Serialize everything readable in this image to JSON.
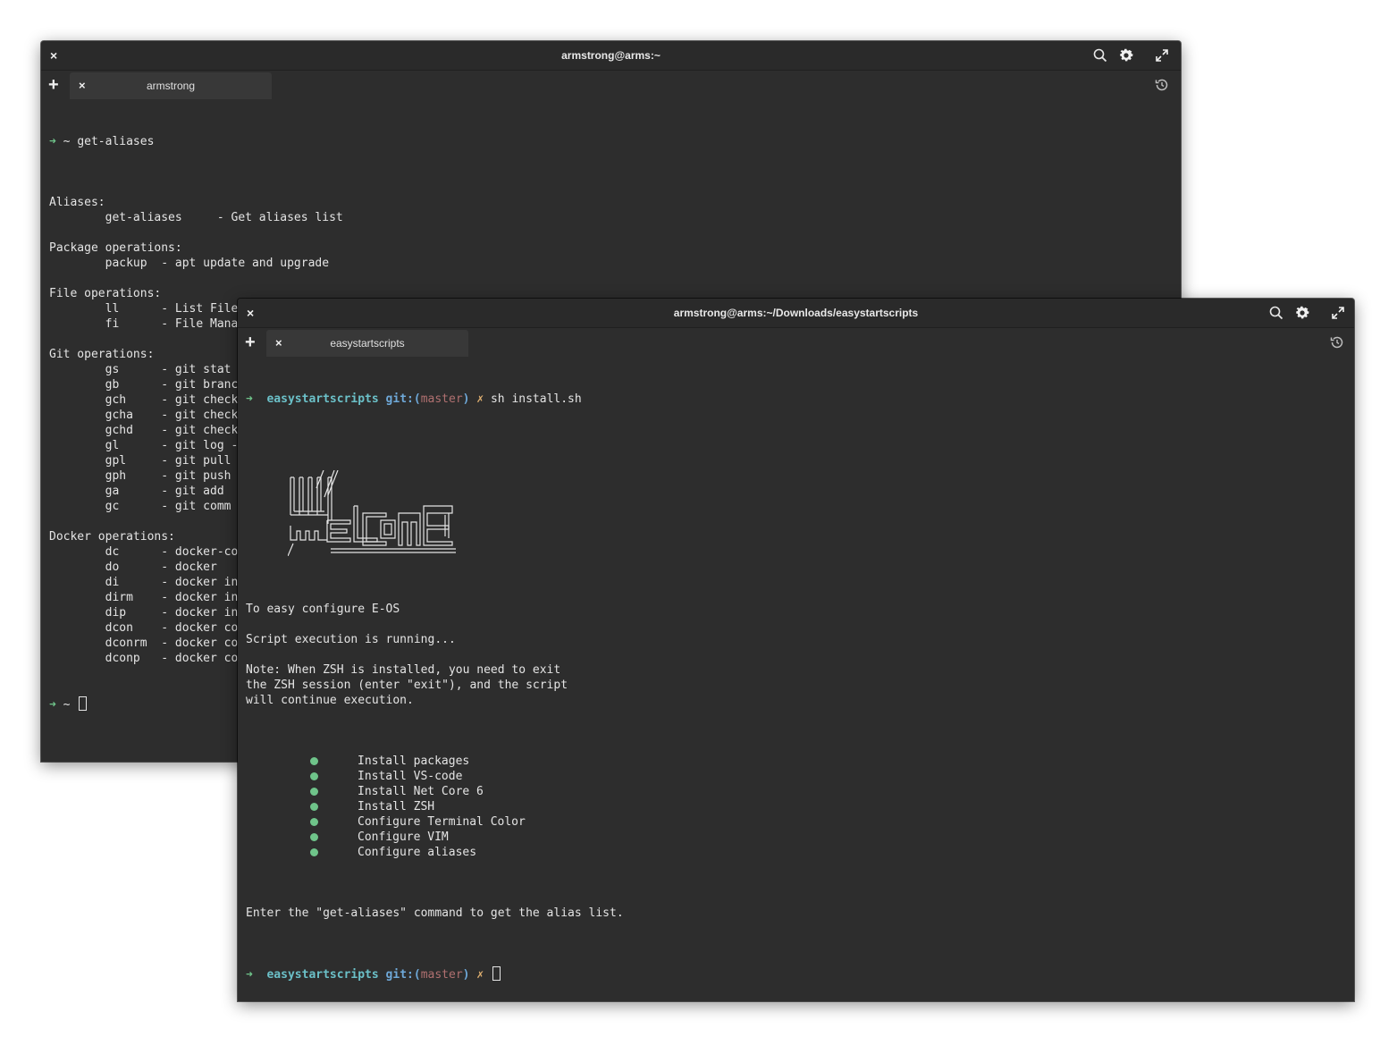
{
  "colors": {
    "terminal_bg": "#2d2d2d",
    "titlebar_bg": "#2a2a2a",
    "text": "#e4e4e4",
    "prompt_arrow": "#6fc48a",
    "dir": "#6bc0c8",
    "git_label": "#6ea8d8",
    "branch": "#b07070",
    "dirty_mark": "#e0b070",
    "bullet": "#6fc48a"
  },
  "window1": {
    "title": "armstrong@arms:~",
    "close_label": "×",
    "tab_add_label": "+",
    "tab": {
      "close_label": "×",
      "label": "armstrong"
    },
    "prompt": {
      "arrow": "➜",
      "dir": "~"
    },
    "command": "get-aliases",
    "lines": [
      "",
      "Aliases:",
      "        get-aliases     - Get aliases list",
      "",
      "Package operations:",
      "        packup  - apt update and upgrade",
      "",
      "File operations:",
      "        ll      - List File",
      "        fi      - File Manager",
      "",
      "Git operations:",
      "        gs      - git stat",
      "        gb      - git branc",
      "        gch     - git check",
      "        gcha    - git check",
      "        gchd    - git check",
      "        gl      - git log -",
      "        gpl     - git pull",
      "        gph     - git push",
      "        ga      - git add",
      "        gc      - git comm",
      "",
      "Docker operations:",
      "        dc      - docker-co",
      "        do      - docker",
      "        di      - docker in",
      "        dirm    - docker in",
      "        dip     - docker in",
      "        dcon    - docker co",
      "        dconrm  - docker co",
      "        dconp   - docker co"
    ]
  },
  "window2": {
    "title": "armstrong@arms:~/Downloads/easystartscripts",
    "close_label": "×",
    "tab_add_label": "+",
    "tab": {
      "close_label": "×",
      "label": "easystartscripts"
    },
    "prompt": {
      "arrow": "➜",
      "dir": "easystartscripts",
      "git_label": "git:(",
      "branch": "master",
      "git_close": ")",
      "dirty": "✗"
    },
    "command": "sh install.sh",
    "banner_text": "WELCOME",
    "intro_lines": [
      "",
      "To easy configure E-OS",
      "",
      "Script execution is running...",
      "",
      "Note: When ZSH is installed, you need to exit",
      "the ZSH session (enter \"exit\"), and the script",
      "will continue execution.",
      ""
    ],
    "steps": [
      "Install packages",
      "Install VS-code",
      "Install Net Core 6",
      "Install ZSH",
      "Configure Terminal Color",
      "Configure VIM",
      "Configure aliases"
    ],
    "outro_lines": [
      "",
      "Enter the \"get-aliases\" command to get the alias list."
    ]
  }
}
